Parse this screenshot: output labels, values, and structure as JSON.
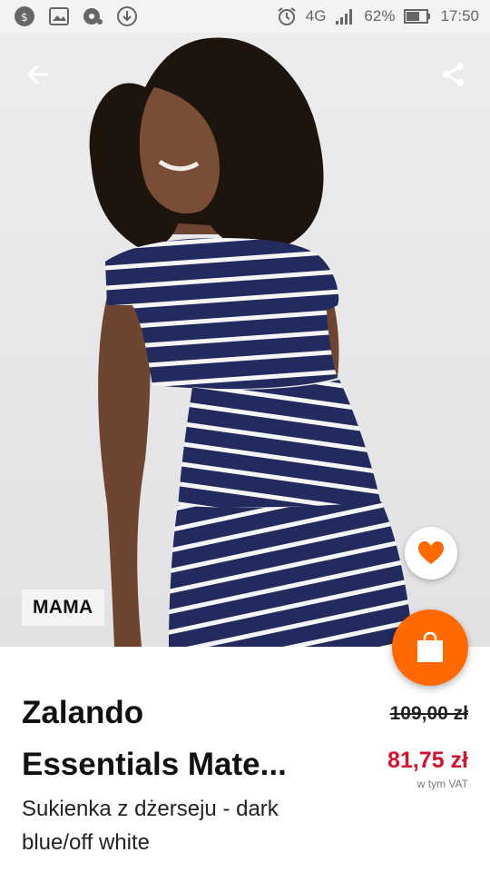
{
  "status_bar": {
    "network": "4G",
    "battery": "62%",
    "time": "17:50"
  },
  "product": {
    "badge": "MAMA",
    "brand_line1": "Zalando",
    "brand_line2": "Essentials Mate...",
    "subtitle": "Sukienka z dżerseju - dark blue/off white",
    "old_price": "109,00 zł",
    "new_price": "81,75 zł",
    "vat_note": "w tym VAT"
  },
  "colors": {
    "accent": "#ff6900",
    "sale": "#d6112e",
    "dress_navy": "#222a5e"
  },
  "icons": {
    "back": "back-arrow-icon",
    "share": "share-icon",
    "favorite": "heart-icon",
    "bag": "shopping-bag-icon"
  }
}
